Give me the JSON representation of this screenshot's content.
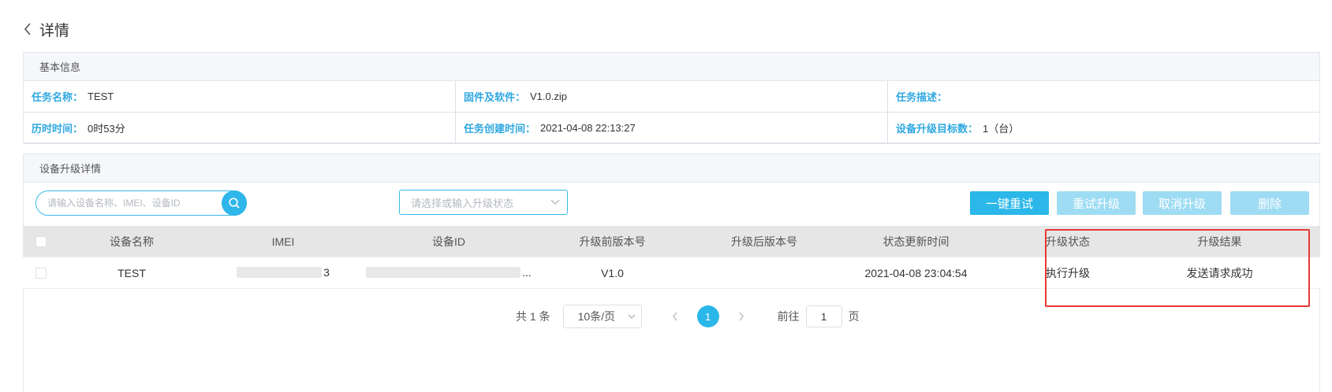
{
  "header": {
    "title": "详情",
    "back_icon": "chevron-left-icon"
  },
  "basic_info": {
    "title": "基本信息",
    "fields": [
      {
        "label": "任务名称：",
        "value": "TEST"
      },
      {
        "label": "固件及软件：",
        "value": "V1.0.zip"
      },
      {
        "label": "任务描述：",
        "value": ""
      },
      {
        "label": "历时时间：",
        "value": "0时53分"
      },
      {
        "label": "任务创建时间：",
        "value": "2021-04-08 22:13:27"
      },
      {
        "label": "设备升级目标数：",
        "value": "1（台）"
      }
    ]
  },
  "details": {
    "title": "设备升级详情",
    "search": {
      "placeholder": "请输入设备名称、IMEI、设备ID",
      "icon": "search-icon"
    },
    "status_select": {
      "placeholder": "请选择或输入升级状态"
    },
    "buttons": {
      "retry_all": "一键重试",
      "retry": "重试升级",
      "cancel": "取消升级",
      "delete": "删除"
    },
    "colors": {
      "accent": "#2bb7e9",
      "disabled": "#9edcf3",
      "highlight": "#e53935",
      "label": "#2fa8e0"
    }
  },
  "table": {
    "columns": [
      "设备名称",
      "IMEI",
      "设备ID",
      "升级前版本号",
      "升级后版本号",
      "状态更新时间",
      "升级状态",
      "升级结果"
    ],
    "rows": [
      {
        "name": "TEST",
        "imei_suffix": "3",
        "device_id_suffix": "...",
        "prev_version": "V1.0",
        "next_version": "",
        "updated": "2021-04-08 23:04:54",
        "status": "执行升级",
        "result": "发送请求成功"
      }
    ]
  },
  "pagination": {
    "total_prefix": "共",
    "total": "1",
    "total_suffix": "条",
    "page_size": "10条/页",
    "current_page": "1",
    "goto_label": "前往",
    "goto_value": "1",
    "goto_suffix": "页"
  }
}
